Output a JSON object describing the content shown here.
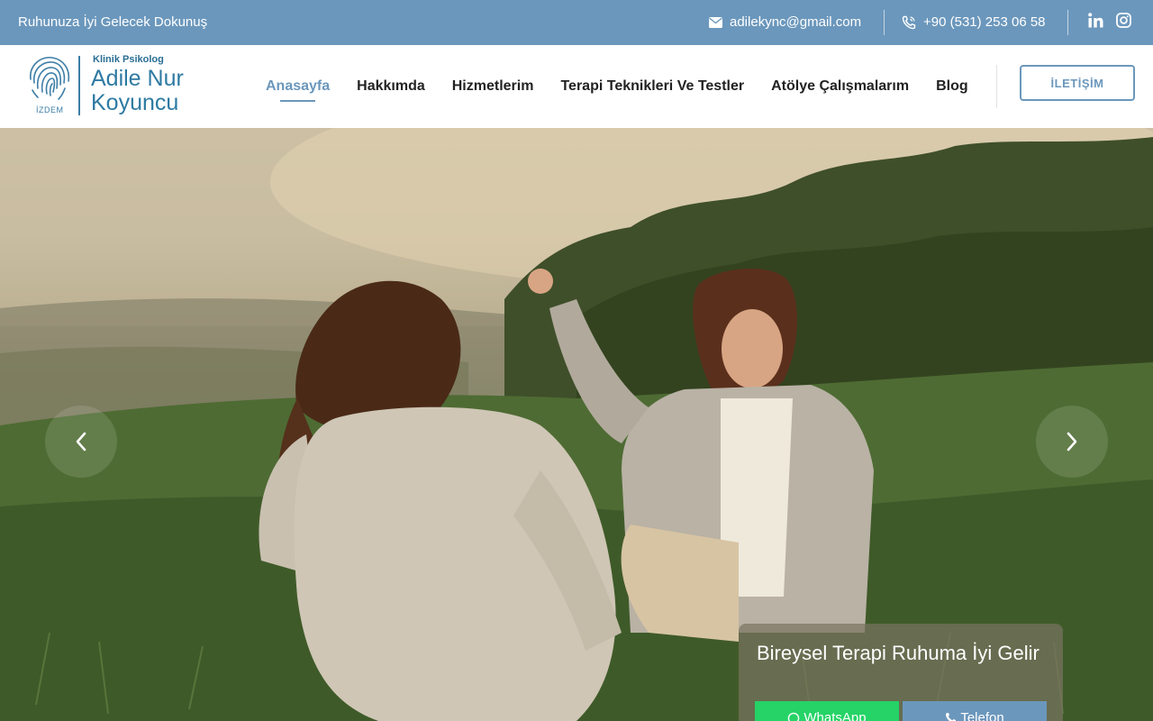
{
  "topbar": {
    "tagline": "Ruhunuza İyi Gelecek Dokunuş",
    "email": "adilekync@gmail.com",
    "phone": "+90 (531) 253 06 58",
    "icons": [
      "envelope-icon",
      "phone-icon",
      "linkedin-icon",
      "instagram-icon"
    ]
  },
  "logo": {
    "small_text": "İZDEM",
    "subtitle": "Klinik Psikolog",
    "name_line1": "Adile Nur",
    "name_line2": "Koyuncu"
  },
  "nav": {
    "items": [
      {
        "label": "Anasayfa",
        "active": true
      },
      {
        "label": "Hakkımda"
      },
      {
        "label": "Hizmetlerim"
      },
      {
        "label": "Terapi Teknikleri Ve Testler"
      },
      {
        "label": "Atölye Çalışmalarım"
      },
      {
        "label": "Blog"
      }
    ],
    "contact_label": "İLETİŞİM"
  },
  "hero": {
    "caption_title": "Bireysel Terapi Ruhuma İyi Gelir",
    "whatsapp_label": "WhatsApp",
    "phone_label": "Telefon"
  },
  "colors": {
    "accent": "#6b97bc",
    "logo_blue": "#2d7aa3",
    "whatsapp": "#25d366"
  }
}
